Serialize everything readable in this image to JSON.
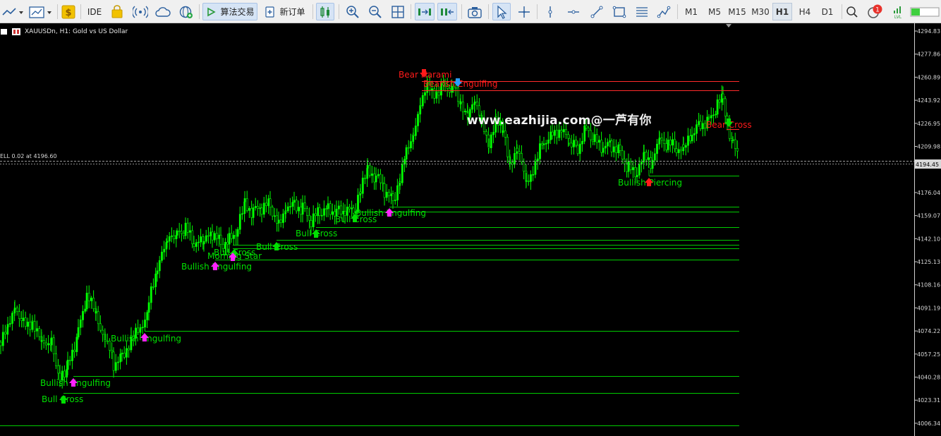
{
  "toolbar": {
    "algo_trading_label": "算法交易",
    "new_order_label": "新订单",
    "ide_label": "IDE",
    "notification_count": "1",
    "timeframes": [
      "M1",
      "M5",
      "M15",
      "M30",
      "H1",
      "H4",
      "D1"
    ],
    "active_timeframe": "H1"
  },
  "chart": {
    "symbol_title": "XAUUSDn, H1:  Gold vs US Dollar",
    "sell_label": "ELL 0.02 at 4196.60",
    "current_price": "4194.45",
    "watermark": "www.eazhijia.com@一芦有你",
    "price_axis": [
      "4294.83",
      "4277.86",
      "4260.89",
      "4243.92",
      "4226.95",
      "4209.98",
      "4193.01",
      "4176.04",
      "4159.07",
      "4142.10",
      "4125.13",
      "4108.16",
      "4091.19",
      "4074.22",
      "4057.25",
      "4040.28",
      "4023.31",
      "4006.34"
    ],
    "patterns": [
      {
        "label": "Bear Harami",
        "type": "bear"
      },
      {
        "label": "Bearish Engulfing",
        "type": "bear"
      },
      {
        "label": "Bear Cross",
        "type": "bear"
      },
      {
        "label": "Bullish Piercing",
        "type": "bull"
      },
      {
        "label": "Bullish Engulfing",
        "type": "bull"
      },
      {
        "label": "Bull Cross",
        "type": "bull"
      },
      {
        "label": "Bull Cross",
        "type": "bull"
      },
      {
        "label": "Bull Cross",
        "type": "bull"
      },
      {
        "label": "Bull Cross",
        "type": "bull"
      },
      {
        "label": "Morning Star",
        "type": "bull"
      },
      {
        "label": "Bullish Engulfing",
        "type": "bull"
      },
      {
        "label": "Bullish Engulfing",
        "type": "bull"
      },
      {
        "label": "Bullish Engulfing",
        "type": "bull"
      },
      {
        "label": "Bull Cross",
        "type": "bull"
      }
    ]
  },
  "colors": {
    "candle": "#00ff00",
    "bull_text": "#00e000",
    "bear_text": "#ff1a1a",
    "level_line": "#00cc00",
    "bear_line": "#ff2a2a",
    "bull_arrow": "#ff22ff",
    "bear_arrow_blue": "#2a9dff"
  }
}
